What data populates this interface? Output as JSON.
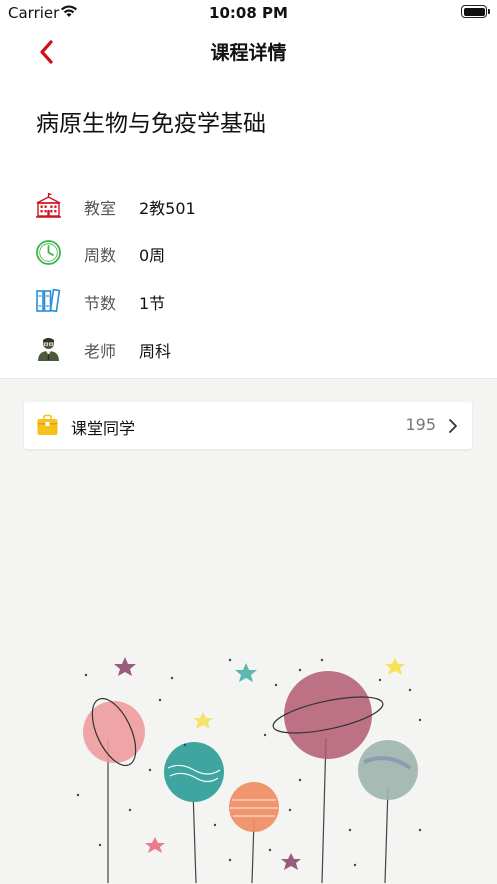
{
  "status_bar": {
    "carrier": "Carrier",
    "time": "10:08 PM",
    "battery_level": 1.0
  },
  "nav": {
    "title": "课程详情"
  },
  "course": {
    "name": "病原生物与免疫学基础"
  },
  "info": [
    {
      "icon": "building-icon",
      "label": "教室",
      "value": "2教501"
    },
    {
      "icon": "clock-icon",
      "label": "周数",
      "value": "0周"
    },
    {
      "icon": "books-icon",
      "label": "节数",
      "value": "1节"
    },
    {
      "icon": "teacher-icon",
      "label": "老师",
      "value": "周科"
    }
  ],
  "classmates": {
    "label": "课堂同学",
    "count": "195"
  },
  "colors": {
    "accent_red": "#d0111b",
    "green": "#3cb44a",
    "blue": "#2a8fd6",
    "yellow": "#f4c21b"
  }
}
